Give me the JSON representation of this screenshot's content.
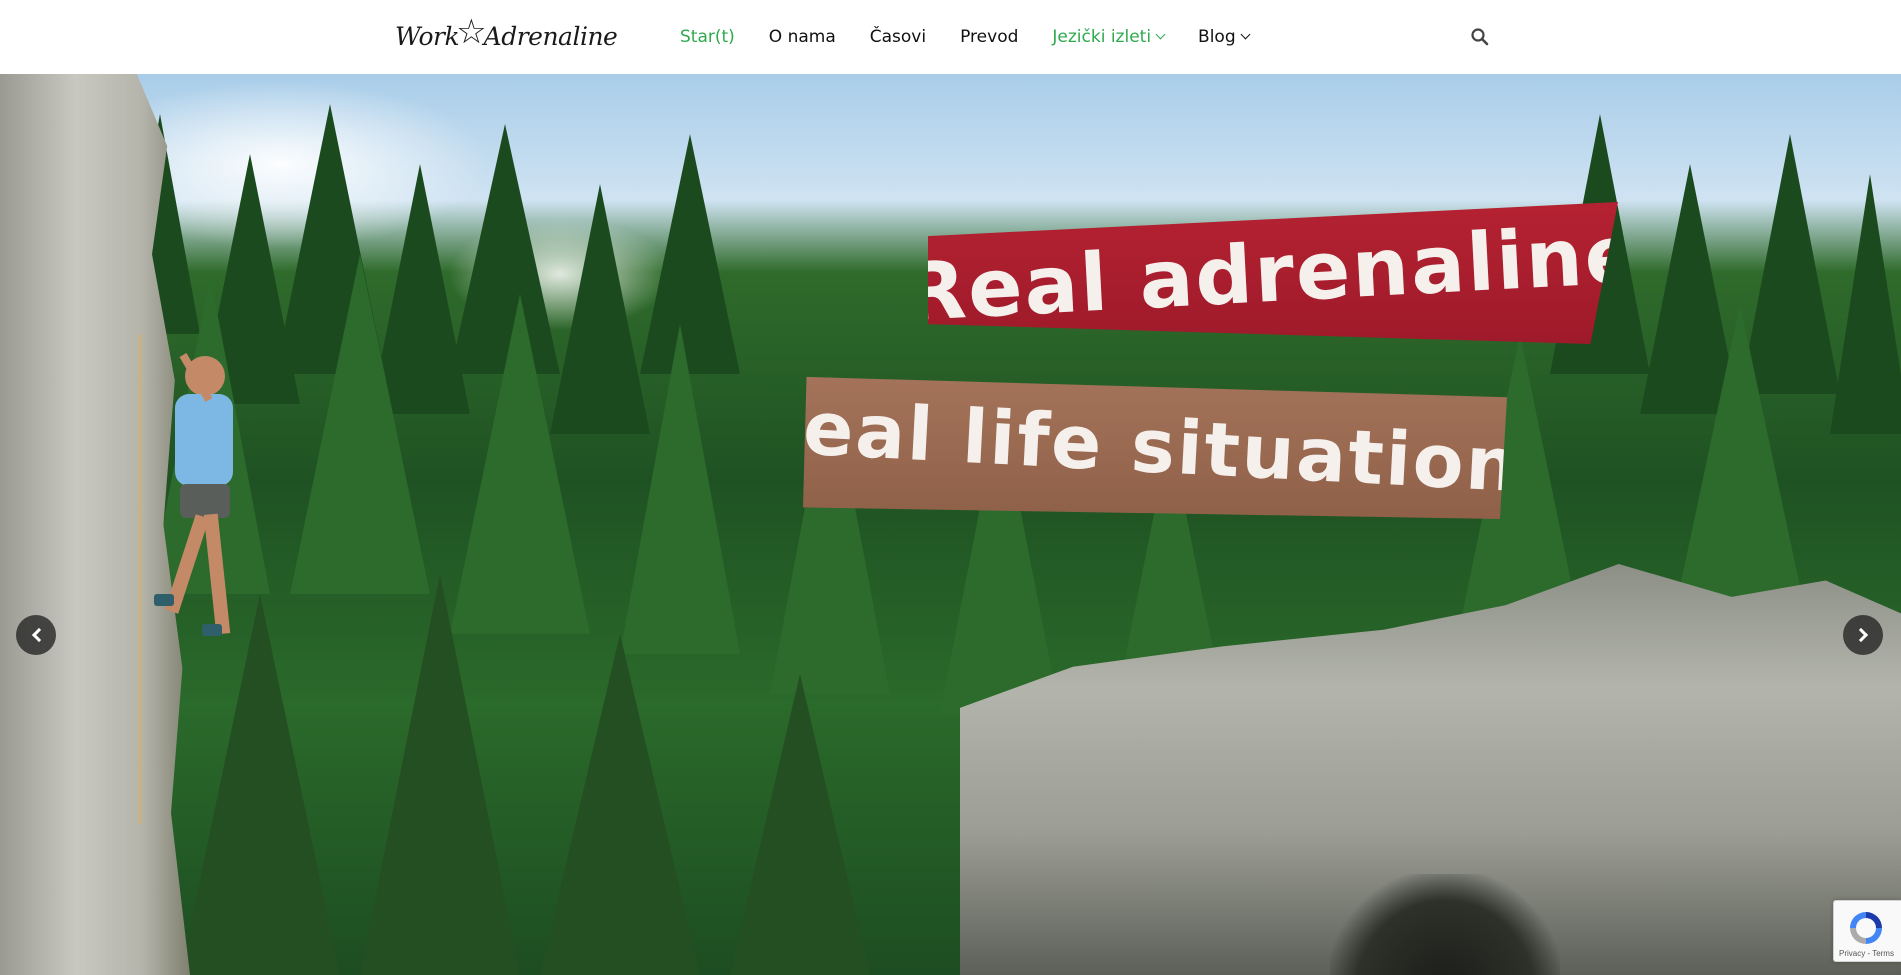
{
  "header": {
    "logo": {
      "text_start": "Work",
      "text_end": "Adrenaline"
    },
    "nav": [
      {
        "label": "Star(t)",
        "active": true,
        "has_dropdown": false
      },
      {
        "label": "O nama",
        "active": false,
        "has_dropdown": false
      },
      {
        "label": "Časovi",
        "active": false,
        "has_dropdown": false
      },
      {
        "label": "Prevod",
        "active": false,
        "has_dropdown": false
      },
      {
        "label": "Jezički izleti",
        "active": true,
        "has_dropdown": true
      },
      {
        "label": "Blog",
        "active": false,
        "has_dropdown": true
      }
    ],
    "search_icon": "search-icon"
  },
  "hero": {
    "banner_primary": "Real adrenaline",
    "banner_secondary": "Real life situations",
    "prev_icon": "chevron-left-icon",
    "next_icon": "chevron-right-icon"
  },
  "recaptcha": {
    "links": "Privacy - Terms"
  },
  "colors": {
    "accent": "#2eaa4e",
    "banner_red": "#a91e2e",
    "banner_brown": "#9a6a52",
    "nav_text": "#111111"
  }
}
